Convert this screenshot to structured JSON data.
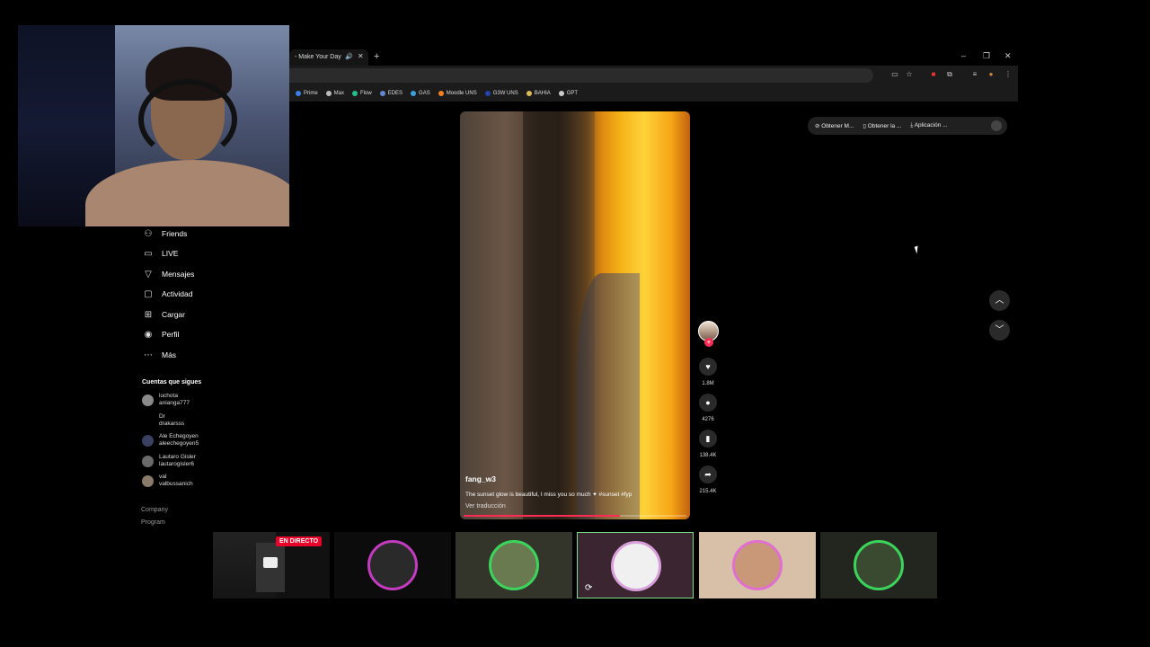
{
  "browser": {
    "tab_title": "- Make Your Day",
    "tab_audio_icon": "speaker-icon",
    "new_tab_label": "+",
    "window_controls": [
      "–",
      "❐",
      "✕"
    ],
    "bookmarks": [
      {
        "label": "Prime",
        "color": "#3d7ee8"
      },
      {
        "label": "Max",
        "color": "#bbbbbb"
      },
      {
        "label": "Flow",
        "color": "#22c08a"
      },
      {
        "label": "EDES",
        "color": "#6688cc"
      },
      {
        "label": "GAS",
        "color": "#3aa0dd"
      },
      {
        "label": "Moodle UNS",
        "color": "#f08020"
      },
      {
        "label": "G3W UNS",
        "color": "#2244aa"
      },
      {
        "label": "BAHIA",
        "color": "#ddbb55"
      },
      {
        "label": "GPT",
        "color": "#cccccc"
      }
    ]
  },
  "sidebar": {
    "items": [
      {
        "label": "Friends",
        "icon": "users-icon"
      },
      {
        "label": "LIVE",
        "icon": "live-icon"
      },
      {
        "label": "Mensajes",
        "icon": "send-icon"
      },
      {
        "label": "Actividad",
        "icon": "activity-icon"
      },
      {
        "label": "Cargar",
        "icon": "upload-icon"
      },
      {
        "label": "Perfil",
        "icon": "profile-icon"
      },
      {
        "label": "Más",
        "icon": "more-icon"
      }
    ],
    "following_title": "Cuentas que sigues",
    "following": [
      {
        "name": "luchota",
        "handle": "anianga777"
      },
      {
        "name": "Dr",
        "handle": "drakarsss"
      },
      {
        "name": "Ale Echegoyen",
        "handle": "aleechegoyen5"
      },
      {
        "name": "Lautaro Gisler",
        "handle": "lautarogisler6"
      },
      {
        "name": "val",
        "handle": "valbussanich"
      }
    ],
    "footer": [
      "Company",
      "Program"
    ]
  },
  "topbar": {
    "chips": [
      "Obtener M...",
      "Obtener la ...",
      "Aplicación ..."
    ]
  },
  "video": {
    "author": "fang_w3",
    "description": "The sunset glow is beautiful, I miss you so much ✦ #sunset #fyp",
    "translate_label": "Ver traducción",
    "progress": 0.7,
    "likes": "1.8M",
    "comments": "4276",
    "saves": "138.4K",
    "shares": "215.4K",
    "accent_color": "#fe2c55"
  },
  "streams": {
    "live_badge": "EN DIRECTO"
  }
}
